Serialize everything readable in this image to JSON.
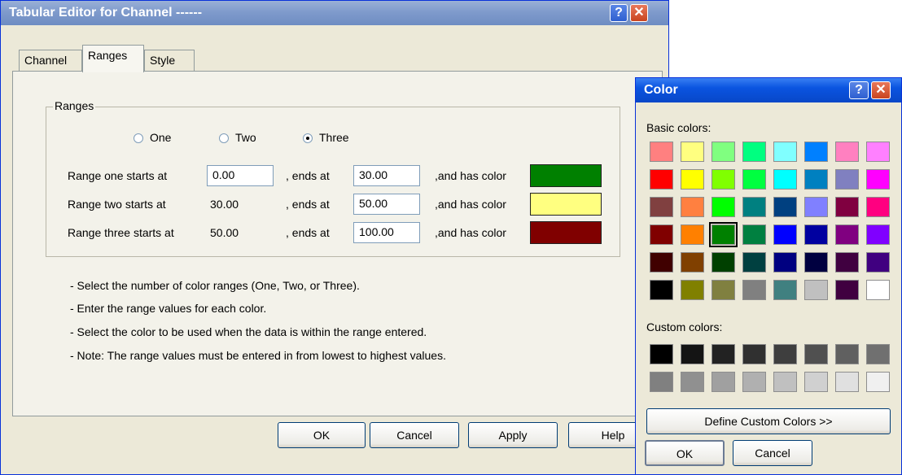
{
  "main_window": {
    "title": "Tabular Editor for Channel ------",
    "tabs": [
      {
        "label": "Channel"
      },
      {
        "label": "Ranges"
      },
      {
        "label": "Style"
      }
    ],
    "group_label": "Ranges",
    "radios": [
      {
        "label": "One",
        "selected": false
      },
      {
        "label": "Two",
        "selected": false
      },
      {
        "label": "Three",
        "selected": true
      }
    ],
    "rows": [
      {
        "label": "Range one starts at",
        "start": "0.00",
        "start_editable": true,
        "ends_label": ", ends at",
        "end": "30.00",
        "color_label": ",and has color",
        "color": "#008000"
      },
      {
        "label": "Range two starts at",
        "start": "30.00",
        "start_editable": false,
        "ends_label": ", ends at",
        "end": "50.00",
        "color_label": ",and has color",
        "color": "#ffff80"
      },
      {
        "label": "Range three starts at",
        "start": "50.00",
        "start_editable": false,
        "ends_label": ", ends at",
        "end": "100.00",
        "color_label": ",and has color",
        "color": "#800000"
      }
    ],
    "notes": [
      "- Select the number of color ranges (One, Two, or Three).",
      "- Enter the range values for each color.",
      "- Select the color to be used when the data is within the range entered.",
      "- Note: The range values must be entered in from lowest to highest values."
    ],
    "buttons": {
      "ok": "OK",
      "cancel": "Cancel",
      "apply": "Apply",
      "help": "Help"
    }
  },
  "color_dialog": {
    "title": "Color",
    "basic_label": "Basic colors:",
    "basic_colors": [
      [
        "#ff8080",
        "#ffff80",
        "#80ff80",
        "#00ff80",
        "#80ffff",
        "#0080ff",
        "#ff80c0",
        "#ff80ff"
      ],
      [
        "#ff0000",
        "#ffff00",
        "#80ff00",
        "#00ff40",
        "#00ffff",
        "#0080c0",
        "#8080c0",
        "#ff00ff"
      ],
      [
        "#804040",
        "#ff8040",
        "#00ff00",
        "#008080",
        "#004080",
        "#8080ff",
        "#800040",
        "#ff0080"
      ],
      [
        "#800000",
        "#ff8000",
        "#008000",
        "#008040",
        "#0000ff",
        "#0000a0",
        "#800080",
        "#8000ff"
      ],
      [
        "#400000",
        "#804000",
        "#004000",
        "#004040",
        "#000080",
        "#000040",
        "#400040",
        "#400080"
      ],
      [
        "#000000",
        "#808000",
        "#808040",
        "#808080",
        "#408080",
        "#c0c0c0",
        "#400040",
        "#ffffff"
      ]
    ],
    "selected_basic": "#008000",
    "custom_label": "Custom colors:",
    "custom_colors": [
      [
        "#000000",
        "#141414",
        "#222222",
        "#303030",
        "#3e3e3e",
        "#505050",
        "#606060",
        "#707070"
      ],
      [
        "#808080",
        "#909090",
        "#a0a0a0",
        "#b0b0b0",
        "#c0c0c0",
        "#d0d0d0",
        "#e0e0e0",
        "#f0f0f0"
      ]
    ],
    "define_label": "Define Custom Colors >>",
    "ok": "OK",
    "cancel": "Cancel"
  }
}
